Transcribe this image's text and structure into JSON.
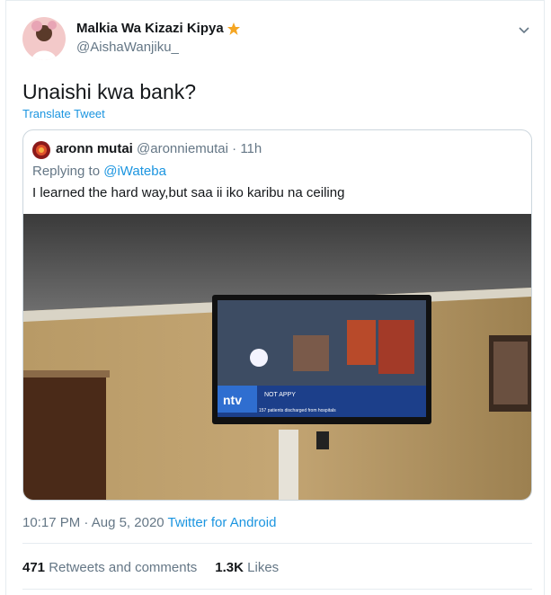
{
  "author": {
    "display_name": "Malkia Wa Kizazi Kipya",
    "handle": "@AishaWanjiku_"
  },
  "tweet": {
    "text": "Unaishi kwa bank?",
    "translate_label": "Translate Tweet"
  },
  "quote": {
    "name": "aronn mutai",
    "handle": "@aronniemutai",
    "separator": "·",
    "age": "11h",
    "replying_prefix": "Replying to",
    "replying_to": "@iWateba",
    "text": "I learned the hard way,but saa ii iko karibu na ceiling",
    "photo": {
      "tv_channel_logo": "ntv",
      "tv_ticker": "NOT APPY",
      "tv_caption": "157 patients discharged from hospitals"
    }
  },
  "meta": {
    "time": "10:17 PM",
    "separator": "·",
    "date": "Aug 5, 2020",
    "source": "Twitter for Android"
  },
  "stats": {
    "retweets_count": "471",
    "retweets_label": "Retweets and comments",
    "likes_count": "1.3K",
    "likes_label": "Likes"
  },
  "colors": {
    "link": "#1b95e0",
    "secondary": "#657786",
    "border": "#ccd6dd"
  },
  "icons": [
    "avatar-photo",
    "verified-star-icon",
    "chevron-down-icon"
  ]
}
